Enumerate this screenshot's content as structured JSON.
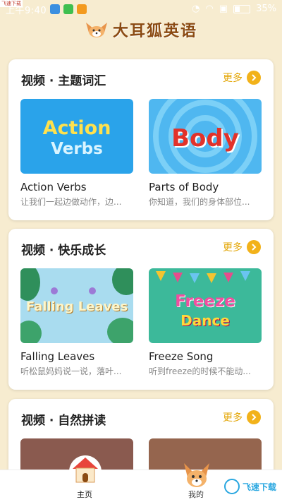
{
  "status_bar": {
    "time": "上午9:40",
    "battery": "35%",
    "battery_level": 0.35
  },
  "corner_label": "飞速下载",
  "header": {
    "app_title": "大耳狐英语"
  },
  "sections": [
    {
      "title": "视频 · 主题词汇",
      "more": "更多",
      "cards": [
        {
          "title": "Action Verbs",
          "desc": "让我们一起边做动作，边...",
          "thumb_text": "Action Verbs",
          "thumb_line1": "Action",
          "thumb_line2": "Verbs"
        },
        {
          "title": "Parts of Body",
          "desc": "你知道，我们的身体部位...",
          "thumb_text": "Body"
        }
      ]
    },
    {
      "title": "视频 · 快乐成长",
      "more": "更多",
      "cards": [
        {
          "title": "Falling Leaves",
          "desc": "听松鼠妈妈说一说，落叶...",
          "thumb_text": "Falling Leaves"
        },
        {
          "title": "Freeze Song",
          "desc": "听到freeze的时候不能动...",
          "thumb_line1": "Freeze",
          "thumb_line2": "Dance"
        }
      ]
    },
    {
      "title": "视频 · 自然拼读",
      "more": "更多",
      "cards": [
        {
          "title": "",
          "desc": ""
        },
        {
          "title": "",
          "desc": ""
        }
      ]
    }
  ],
  "bottom_nav": {
    "items": [
      {
        "label": "主页",
        "icon": "house-icon"
      },
      {
        "label": "我的",
        "icon": "fox-icon"
      }
    ],
    "watermark": "飞速下载"
  },
  "colors": {
    "background": "#f7ecd0",
    "accent": "#f2b21a",
    "more_text": "#e3a400",
    "header_title": "#8a4a12"
  }
}
